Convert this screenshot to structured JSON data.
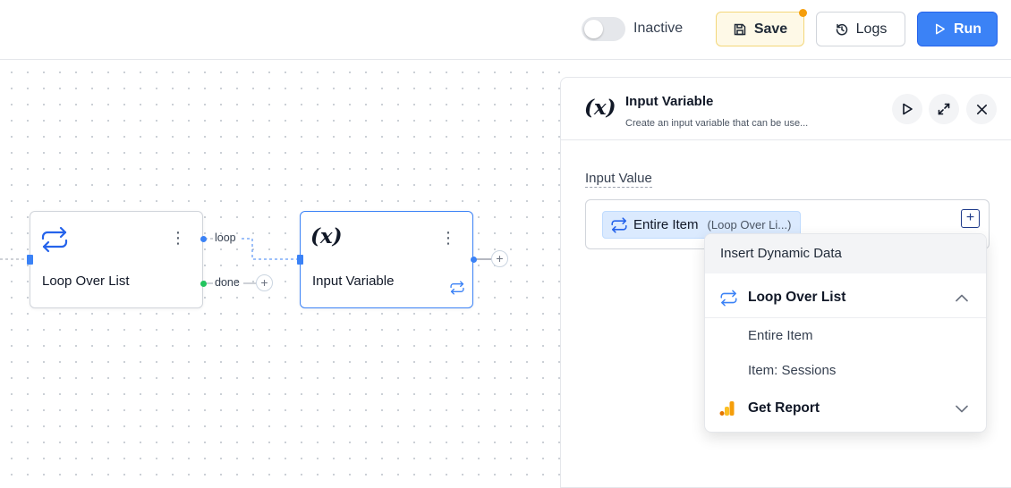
{
  "topbar": {
    "toggle_label": "Inactive",
    "toggle_on": false,
    "save_label": "Save",
    "logs_label": "Logs",
    "run_label": "Run",
    "unsaved_dot_color": "#f59e0b",
    "run_color": "#3b82f6"
  },
  "canvas": {
    "nodes": [
      {
        "title": "Loop Over List",
        "icon": "loop-icon"
      },
      {
        "title": "Input Variable",
        "icon": "variable-icon",
        "badge_icon": "loop-icon",
        "selected": true
      }
    ],
    "edges": {
      "loop_label": "loop",
      "done_label": "done"
    },
    "add_symbol": "+"
  },
  "panel": {
    "icon_text": "(x)",
    "title": "Input Variable",
    "subtitle": "Create an input variable that can be use...",
    "field_label": "Input Value",
    "chip_main": "Entire Item",
    "chip_sub": "(Loop Over Li...)",
    "plus_symbol": "+"
  },
  "dropdown": {
    "header": "Insert Dynamic Data",
    "groups": [
      {
        "label": "Loop Over List",
        "icon": "loop-icon",
        "expanded": true,
        "items": [
          "Entire Item",
          "Item: Sessions"
        ]
      },
      {
        "label": "Get Report",
        "icon": "analytics-icon",
        "expanded": false,
        "items": []
      }
    ]
  }
}
